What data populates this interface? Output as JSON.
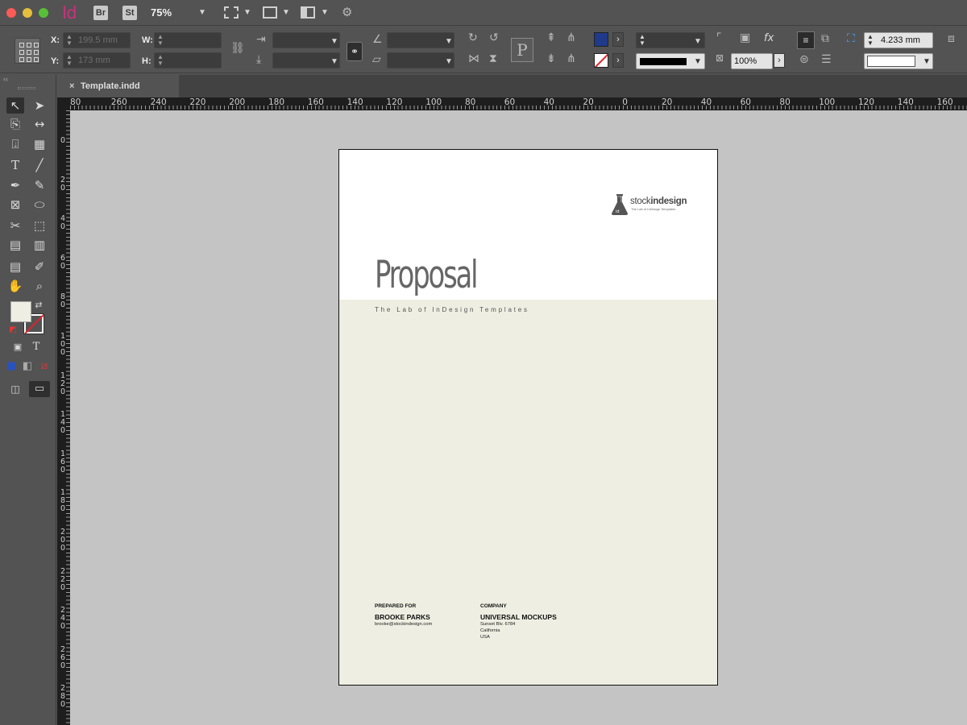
{
  "app": {
    "id_label": "Id",
    "bridge_label": "Br",
    "stock_label": "St",
    "zoom": "75%"
  },
  "control": {
    "x_label": "X:",
    "y_label": "Y:",
    "w_label": "W:",
    "h_label": "H:",
    "x_value": "199.5 mm",
    "y_value": "173 mm",
    "opacity": "100%",
    "spacing_value": "4.233 mm",
    "fx_label": "fx",
    "fill_color": "#1f3a8a",
    "stroke_color": "#e2232d"
  },
  "tab": {
    "filename": "Template.indd",
    "close": "×"
  },
  "ruler": {
    "h_labels": [
      "80",
      "260",
      "240",
      "220",
      "200",
      "180",
      "160",
      "140",
      "120",
      "100",
      "80",
      "60",
      "40",
      "20",
      "0",
      "20",
      "40",
      "60",
      "80",
      "100",
      "120",
      "140",
      "160",
      "1"
    ],
    "v_labels": [
      "0",
      "2\n0",
      "4\n0",
      "6\n0",
      "8\n0",
      "1\n0\n0",
      "1\n2\n0",
      "1\n4\n0",
      "1\n6\n0",
      "1\n8\n0",
      "2\n0\n0",
      "2\n2\n0",
      "2\n4\n0",
      "2\n6\n0",
      "2\n8\n0"
    ]
  },
  "document": {
    "logo_stock": "stock",
    "logo_indesign": "indesign",
    "logo_sub": "The Lab of InDesign Templates",
    "title": "Proposal",
    "tagline": "The Lab of InDesign Templates",
    "prepared_for_label": "PREPARED FOR",
    "prepared_for_name": "BROOKE PARKS",
    "prepared_for_email": "brooke@stockindesign.com",
    "company_label": "COMPANY",
    "company_name": "UNIVERSAL MOCKUPS",
    "company_address": [
      "Sunset Blv. 6784",
      "California",
      "USA"
    ],
    "band_color": "#eeeee2"
  }
}
